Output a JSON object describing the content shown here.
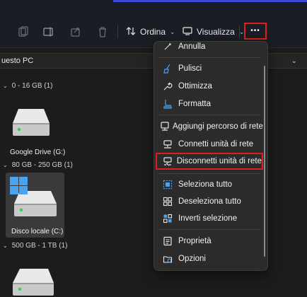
{
  "toolbar": {
    "sort_label": "Ordina",
    "view_label": "Visualizza",
    "more_label": "•••"
  },
  "address": {
    "location": "uesto PC"
  },
  "groups": [
    {
      "label": "0 - 16 GB (1)"
    },
    {
      "label": "80 GB - 250 GB (1)"
    },
    {
      "label": "500 GB - 1 TB (1)"
    }
  ],
  "drives": [
    {
      "name": "Google Drive (G:)",
      "icon": "hard-drive-icon"
    },
    {
      "name": "Disco locale (C:)",
      "icon": "windows-drive-icon"
    },
    {
      "name": "",
      "icon": "hard-drive-icon"
    }
  ],
  "menu": {
    "items": [
      {
        "label": "Annulla",
        "icon": "undo-icon"
      },
      {
        "label": "Pulisci",
        "icon": "broom-icon"
      },
      {
        "label": "Ottimizza",
        "icon": "wrench-icon"
      },
      {
        "label": "Formatta",
        "icon": "format-drive-icon"
      },
      {
        "label": "Aggiungi percorso di rete",
        "icon": "add-network-location-icon"
      },
      {
        "label": "Connetti unità di rete",
        "icon": "map-network-drive-icon"
      },
      {
        "label": "Disconnetti unità di rete",
        "icon": "disconnect-network-drive-icon"
      },
      {
        "label": "Seleziona tutto",
        "icon": "select-all-icon"
      },
      {
        "label": "Deseleziona tutto",
        "icon": "select-none-icon"
      },
      {
        "label": "Inverti selezione",
        "icon": "invert-selection-icon"
      },
      {
        "label": "Proprietà",
        "icon": "properties-icon"
      },
      {
        "label": "Opzioni",
        "icon": "options-icon"
      }
    ]
  },
  "colors": {
    "highlight_border": "#e0201c",
    "menu_bg": "#2b2b2b",
    "window_bg": "#1c1c1c",
    "icon_blue": "#4aa3f0"
  }
}
